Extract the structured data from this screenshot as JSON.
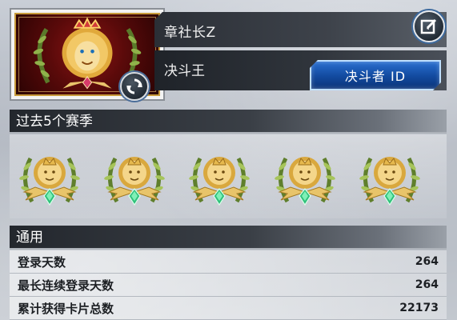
{
  "profile": {
    "name": "章社长Z",
    "title": "决斗王",
    "duelist_id_label": "决斗者 ID",
    "icons": {
      "avatar": "lion-crest-icon",
      "refresh": "refresh-icon",
      "edit": "edit-icon"
    }
  },
  "seasons": {
    "header": "过去5个赛季",
    "medals": [
      {
        "icon": "season-medal-icon"
      },
      {
        "icon": "season-medal-icon"
      },
      {
        "icon": "season-medal-icon"
      },
      {
        "icon": "season-medal-icon"
      },
      {
        "icon": "season-medal-icon"
      }
    ]
  },
  "general": {
    "header": "通用",
    "stats": [
      {
        "label": "登录天数",
        "value": "264"
      },
      {
        "label": "最长连续登录天数",
        "value": "264"
      },
      {
        "label": "累计获得卡片总数",
        "value": "22173"
      }
    ]
  },
  "colors": {
    "accent_blue": "#124a9e",
    "header_dark": "#23272d",
    "gold": "#c89b3a",
    "emerald": "#2fbf7a"
  }
}
